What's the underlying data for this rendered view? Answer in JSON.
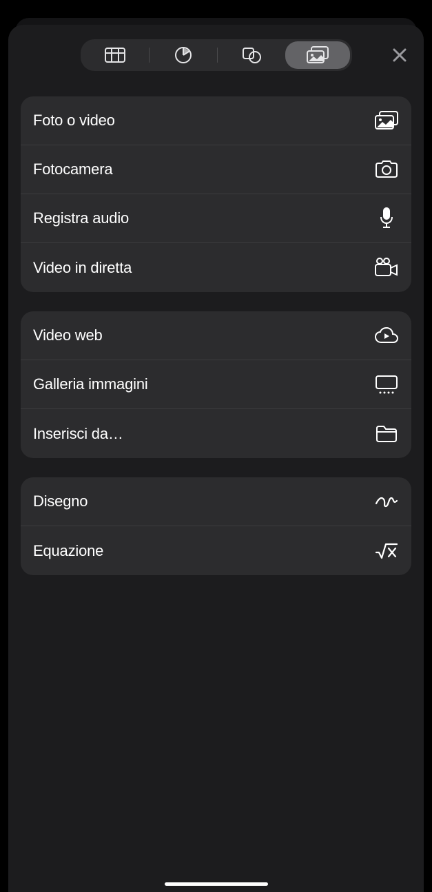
{
  "tabs": {
    "table": "table",
    "chart": "chart",
    "shape": "shape",
    "media": "media",
    "selected": 3
  },
  "groups": [
    {
      "items": [
        {
          "label": "Foto o video",
          "icon": "photos-icon"
        },
        {
          "label": "Fotocamera",
          "icon": "camera-icon"
        },
        {
          "label": "Registra audio",
          "icon": "microphone-icon"
        },
        {
          "label": "Video in diretta",
          "icon": "video-camera-icon"
        }
      ]
    },
    {
      "items": [
        {
          "label": "Video web",
          "icon": "cloud-play-icon"
        },
        {
          "label": "Galleria immagini",
          "icon": "gallery-icon"
        },
        {
          "label": "Inserisci da…",
          "icon": "folder-icon"
        }
      ]
    },
    {
      "items": [
        {
          "label": "Disegno",
          "icon": "scribble-icon"
        },
        {
          "label": "Equazione",
          "icon": "sqrt-icon"
        }
      ]
    }
  ]
}
